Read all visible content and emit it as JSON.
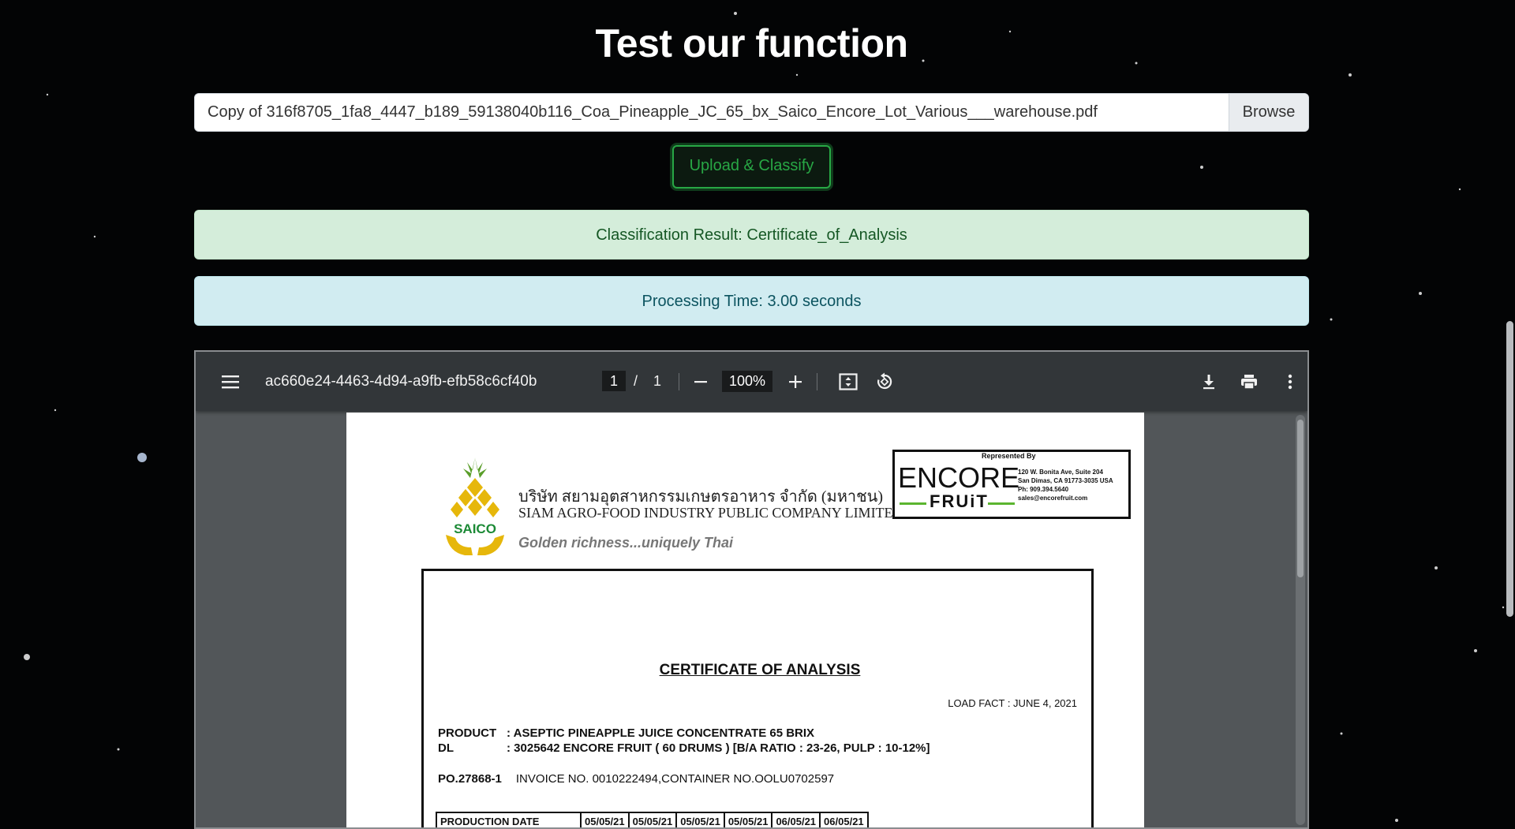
{
  "page": {
    "title": "Test our function"
  },
  "upload": {
    "file_name": "Copy of 316f8705_1fa8_4447_b189_59138040b116_Coa_Pineapple_JC_65_bx_Saico_Encore_Lot_Various___warehouse.pdf",
    "browse_label": "Browse",
    "submit_label": "Upload & Classify"
  },
  "results": {
    "classification": "Classification Result: Certificate_of_Analysis",
    "processing_time": "Processing Time: 3.00 seconds"
  },
  "colors": {
    "success_bg": "#d4edda",
    "info_bg": "#d1ecf1",
    "accent_green": "#28a745",
    "viewer_toolbar": "#323639"
  },
  "pdf_viewer": {
    "document_title": "ac660e24-4463-4d94-a9fb-efb58c6cf40b",
    "current_page": "1",
    "page_separator": "/",
    "total_pages": "1",
    "zoom": "100%",
    "icons": [
      "menu-icon",
      "zoom-out-icon",
      "zoom-in-icon",
      "fit-page-icon",
      "rotate-icon",
      "download-icon",
      "print-icon",
      "more-options-icon"
    ]
  },
  "document": {
    "company_thai": "บริษัท สยามอุตสาหกรรมเกษตรอาหาร จำกัด (มหาชน)",
    "company_en": "SIAM AGRO-FOOD INDUSTRY PUBLIC COMPANY LIMITED",
    "tagline": "Golden richness...uniquely Thai",
    "saico_logo_text": "SAICO",
    "encore": {
      "represented_by": "Represented By",
      "brand_top": "ENCORE",
      "brand_bottom": "FRUiT",
      "address_1": "120 W. Bonita Ave, Suite 204",
      "address_2": "San Dimas, CA 91773-3035 USA",
      "phone": "Ph: 909.394.5640",
      "email": "sales@encorefruit.com"
    },
    "heading": "CERTIFICATE OF ANALYSIS",
    "load_fact": "LOAD FACT : JUNE 4, 2021",
    "product_label": "PRODUCT",
    "product_value": ":  ASEPTIC PINEAPPLE JUICE CONCENTRATE 65 BRIX",
    "dl_label": "DL",
    "dl_value": ":  3025642 ENCORE FRUIT ( 60 DRUMS ) [B/A RATIO : 23-26, PULP : 10-12%]",
    "po_label": "PO.27868-1",
    "po_value": "INVOICE NO. 0010222494,CONTAINER NO.OOLU0702597",
    "table_header": "PRODUCTION DATE",
    "production_dates": [
      "05/05/21",
      "05/05/21",
      "05/05/21",
      "05/05/21",
      "06/05/21",
      "06/05/21"
    ]
  }
}
